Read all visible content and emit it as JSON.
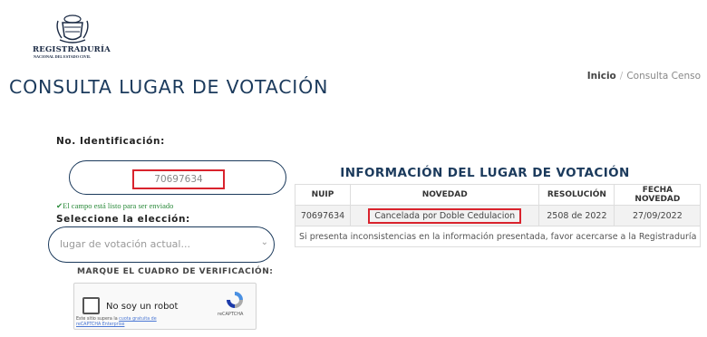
{
  "header": {
    "logo_text": "REGISTRADURÍA",
    "logo_subtext": "NACIONAL DEL ESTADO CIVIL",
    "page_title": "CONSULTA LUGAR DE VOTACIÓN",
    "breadcrumb": {
      "home": "Inicio",
      "separator": "/",
      "current": "Consulta Censo"
    }
  },
  "form": {
    "id_label": "No. Identificación:",
    "id_value": "70697634",
    "valid_message": "✔El campo está listo para ser enviado",
    "select_label": "Seleccione la elección:",
    "select_placeholder": "lugar de votación actual...",
    "captcha_label": "MARQUE EL CUADRO DE VERIFICACIÓN:"
  },
  "captcha": {
    "checkbox_label": "No soy un robot",
    "brand": "reCAPTCHA",
    "fine_print_prefix": "Este sitio supera la",
    "fine_print_link": "cuota gratuita de reCAPTCHA Enterprise"
  },
  "info": {
    "title": "INFORMACIÓN DEL LUGAR DE VOTACIÓN",
    "columns": [
      "NUIP",
      "NOVEDAD",
      "RESOLUCIÓN",
      "FECHA NOVEDAD"
    ],
    "row": {
      "nuip": "70697634",
      "novedad": "Cancelada por Doble Cedulacion",
      "resolucion": "2508 de 2022",
      "fecha": "27/09/2022"
    },
    "note": "Si presenta inconsistencias en la información presentada, favor acercarse a la Registraduría"
  },
  "colors": {
    "brand_navy": "#1b3a5c",
    "highlight_red": "#d9232d",
    "valid_green": "#2a8a3a"
  }
}
